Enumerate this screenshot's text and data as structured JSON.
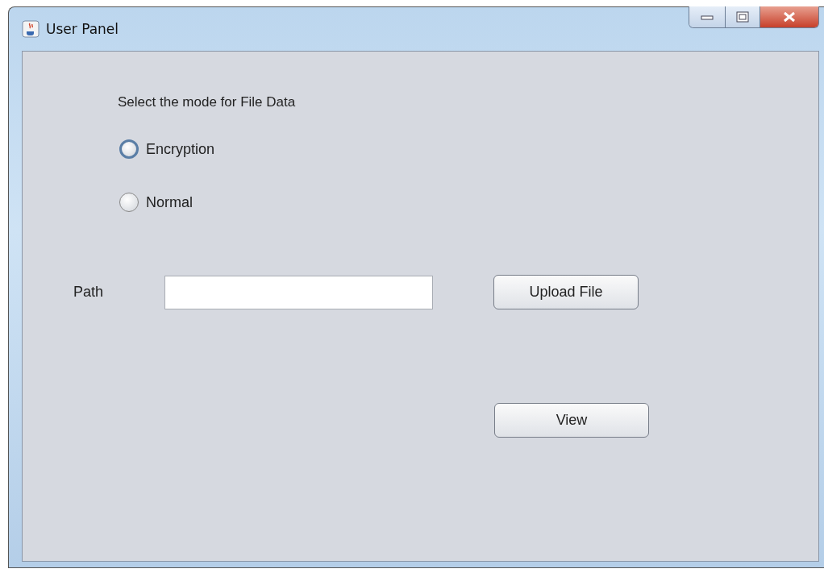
{
  "window": {
    "title": "User Panel"
  },
  "prompt": "Select the mode for File Data",
  "modes": [
    {
      "label": "Encryption",
      "selected": false,
      "focused": true
    },
    {
      "label": "Normal",
      "selected": false,
      "focused": false
    }
  ],
  "path": {
    "label": "Path"
  },
  "buttons": [
    {
      "kind": "upload",
      "label": "Upload File"
    },
    {
      "kind": "view",
      "label": "View"
    }
  ]
}
